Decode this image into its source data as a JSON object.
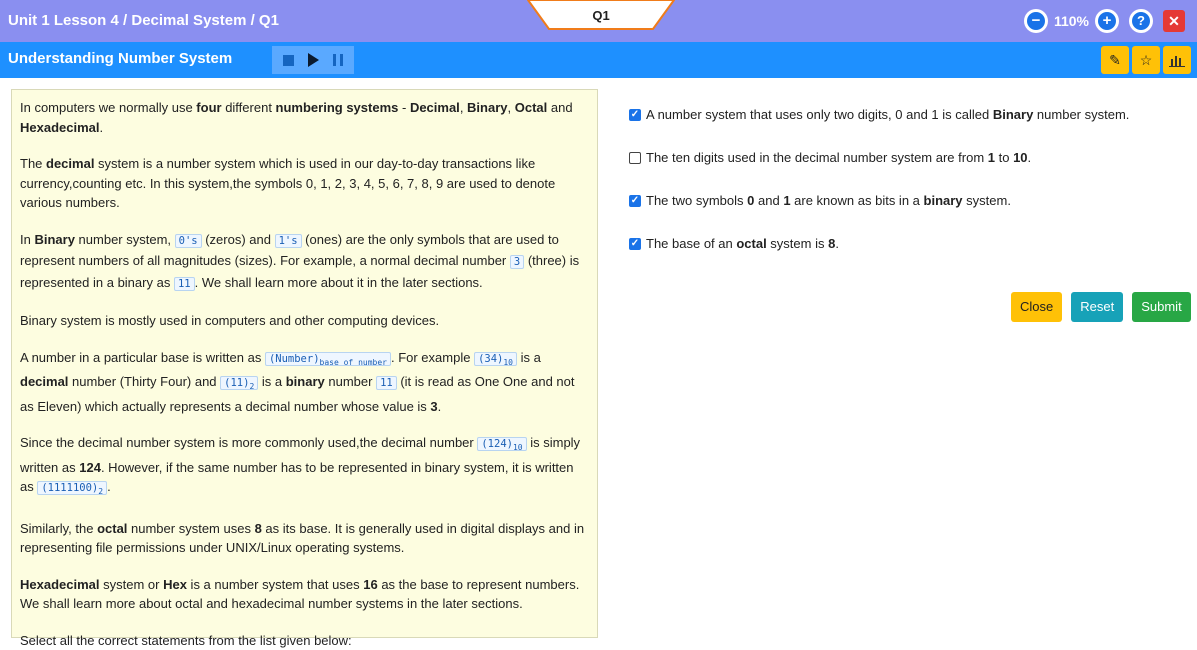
{
  "header": {
    "breadcrumb": "Unit 1 Lesson 4 / Decimal System / Q1",
    "question_tab": "Q1",
    "zoom": "110%",
    "zoom_out_icon": "minus-circle",
    "zoom_in_icon": "plus-circle",
    "help_icon": "question-circle",
    "close_icon": "close-x"
  },
  "subheader": {
    "title": "Understanding Number System",
    "media_icons": [
      "stop-icon",
      "play-icon",
      "pause-icon"
    ],
    "tools": [
      "pencil-icon",
      "star-icon",
      "chart-icon"
    ]
  },
  "lesson": {
    "p1": {
      "a": "In computers we normally use ",
      "b": "four",
      "c": " different ",
      "d": "numbering systems",
      "e": " - ",
      "f": "Decimal",
      "g": ", ",
      "h": "Binary",
      "i": ", ",
      "j": "Octal",
      "k": " and ",
      "l": "Hexadecimal",
      "m": "."
    },
    "p2": {
      "a": "The ",
      "b": "decimal",
      "c": " system is a number system which is used in our day-to-day transactions like currency,counting etc. In this system,the symbols 0, 1, 2, 3, 4, 5, 6, 7, 8, 9 are used to denote various numbers."
    },
    "p3": {
      "a": "In ",
      "b": "Binary",
      "c": " number system, ",
      "code1": "0's",
      "d": " (zeros) and ",
      "code2": "1's",
      "e": " (ones) are the only symbols that are used to represent numbers of all magnitudes (sizes). For example, a normal decimal number ",
      "code3": "3",
      "f": " (three) is represented in a binary as ",
      "code4": "11",
      "g": ". We shall learn more about it in the later sections."
    },
    "p4": "Binary system is mostly used in computers and other computing devices.",
    "p5": {
      "a": "A number in a particular base is written as ",
      "code1": "(Number)",
      "code1sub": "base of number",
      "b": ". For example ",
      "code2": "(34)",
      "code2sub": "10",
      "c": " is a ",
      "d": "decimal",
      "e": " number (Thirty Four) and ",
      "code3": "(11)",
      "code3sub": "2",
      "f": " is a ",
      "g": "binary",
      "h": " number ",
      "code4": "11",
      "i": " (it is read as One One and not as Eleven) which actually represents a decimal number whose value is ",
      "j": "3",
      "k": "."
    },
    "p6": {
      "a": "Since the decimal number system is more commonly used,the decimal number ",
      "code1": "(124)",
      "code1sub": "10",
      "b": " is simply written as ",
      "c": "124",
      "d": ". However, if the same number has to be represented in binary system, it is written as ",
      "code2": "(1111100)",
      "code2sub": "2",
      "e": "."
    },
    "p7": {
      "a": "Similarly, the ",
      "b": "octal",
      "c": " number system uses ",
      "d": "8",
      "e": " as its base. It is generally used in digital displays and in representing file permissions under UNIX/Linux operating systems."
    },
    "p8": {
      "a": "Hexadecimal",
      "b": " system or ",
      "c": "Hex",
      "d": " is a number system that uses ",
      "e": "16",
      "f": " as the base to represent numbers. We shall learn more about octal and hexadecimal number systems in the later sections."
    },
    "p9": "Select all the correct statements from the list given below:"
  },
  "options": [
    {
      "checked": true,
      "a": "A number system that uses only two digits, 0 and 1 is called ",
      "b": "Binary",
      "c": " number system."
    },
    {
      "checked": false,
      "a": "The ten digits used in the decimal number system are from ",
      "b": "1",
      "c": " to ",
      "d": "10",
      "e": "."
    },
    {
      "checked": true,
      "a": "The two symbols ",
      "b": "0",
      "c": " and ",
      "d": "1",
      "e": " are known as bits in a ",
      "f": "binary",
      "g": " system."
    },
    {
      "checked": true,
      "a": "The base of an ",
      "b": "octal",
      "c": " system is ",
      "d": "8",
      "e": "."
    }
  ],
  "buttons": {
    "close": "Close",
    "reset": "Reset",
    "submit": "Submit"
  },
  "colors": {
    "topbar": "#8a8ff0",
    "subbar": "#1e90ff",
    "panel": "#fdfde0",
    "accent": "#ffc107"
  }
}
